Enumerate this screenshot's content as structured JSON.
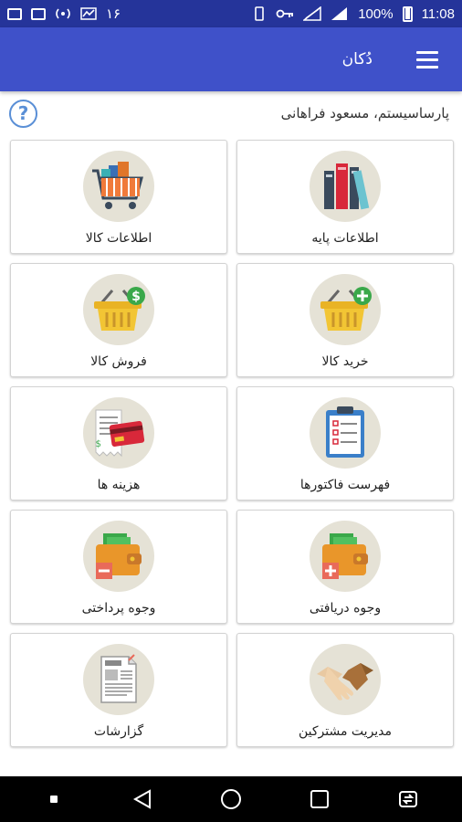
{
  "status_bar": {
    "left_number": "۱۶",
    "battery": "100%",
    "time": "11:08"
  },
  "app_bar": {
    "title": "دُکان",
    "menu_icon": "hamburger-menu-icon"
  },
  "user": {
    "name": "پارساسیستم، مسعود فراهانی",
    "help_icon": "help-question-icon",
    "help_glyph": "?"
  },
  "tiles": [
    {
      "label": "اطلاعات پایه",
      "icon": "books-icon"
    },
    {
      "label": "اطلاعات کالا",
      "icon": "shopping-cart-icon"
    },
    {
      "label": "خرید کالا",
      "icon": "basket-plus-icon"
    },
    {
      "label": "فروش کالا",
      "icon": "basket-dollar-icon"
    },
    {
      "label": "فهرست فاکتورها",
      "icon": "clipboard-checklist-icon"
    },
    {
      "label": "هزینه ها",
      "icon": "credit-card-receipt-icon"
    },
    {
      "label": "وجوه دریافتی",
      "icon": "wallet-plus-icon"
    },
    {
      "label": "وجوه پرداختی",
      "icon": "wallet-minus-icon"
    },
    {
      "label": "مدیریت مشترکین",
      "icon": "handshake-icon"
    },
    {
      "label": "گزارشات",
      "icon": "report-document-icon"
    }
  ],
  "nav": {
    "dot": "nav-dot-icon",
    "back": "back-triangle-icon",
    "home": "home-circle-icon",
    "recents": "recents-square-icon",
    "switch": "switch-app-icon"
  },
  "colors": {
    "status_bar": "#25349a",
    "app_bar": "#3f51c9",
    "tile_circle": "#e5e2d6",
    "help": "#5a8fd6"
  }
}
